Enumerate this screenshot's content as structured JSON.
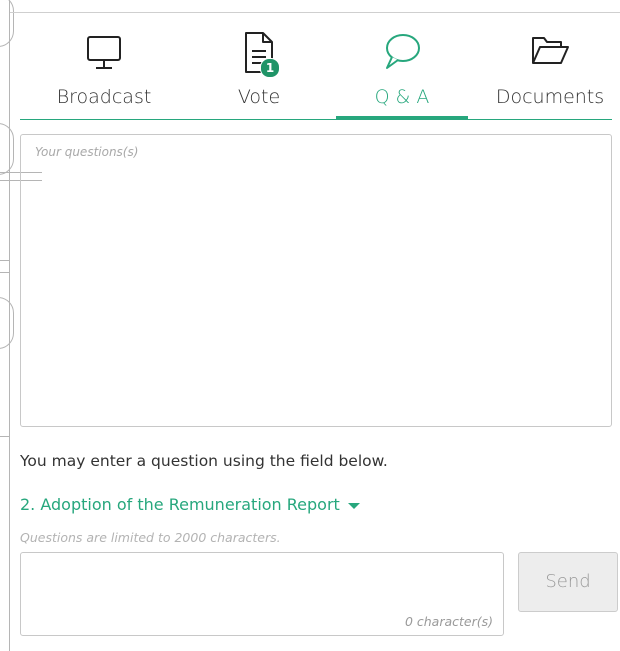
{
  "tabs": [
    {
      "label": "Broadcast",
      "icon": "monitor-icon"
    },
    {
      "label": "Vote",
      "icon": "document-icon",
      "badge": "1"
    },
    {
      "label": "Q & A",
      "icon": "speech-bubble-icon",
      "active": true
    },
    {
      "label": "Documents",
      "icon": "folder-open-icon"
    }
  ],
  "questions_box": {
    "placeholder": "Your questions(s)"
  },
  "hint": "You may enter a question using the field below.",
  "agenda_item": "2. Adoption of the Remuneration Report",
  "limit_note": "Questions are limited to 2000 characters.",
  "question_input": {
    "counter": "0 character(s)"
  },
  "send_label": "Send",
  "colors": {
    "accent": "#27a77d",
    "badge": "#1f9467",
    "border": "#c8c8c8"
  }
}
